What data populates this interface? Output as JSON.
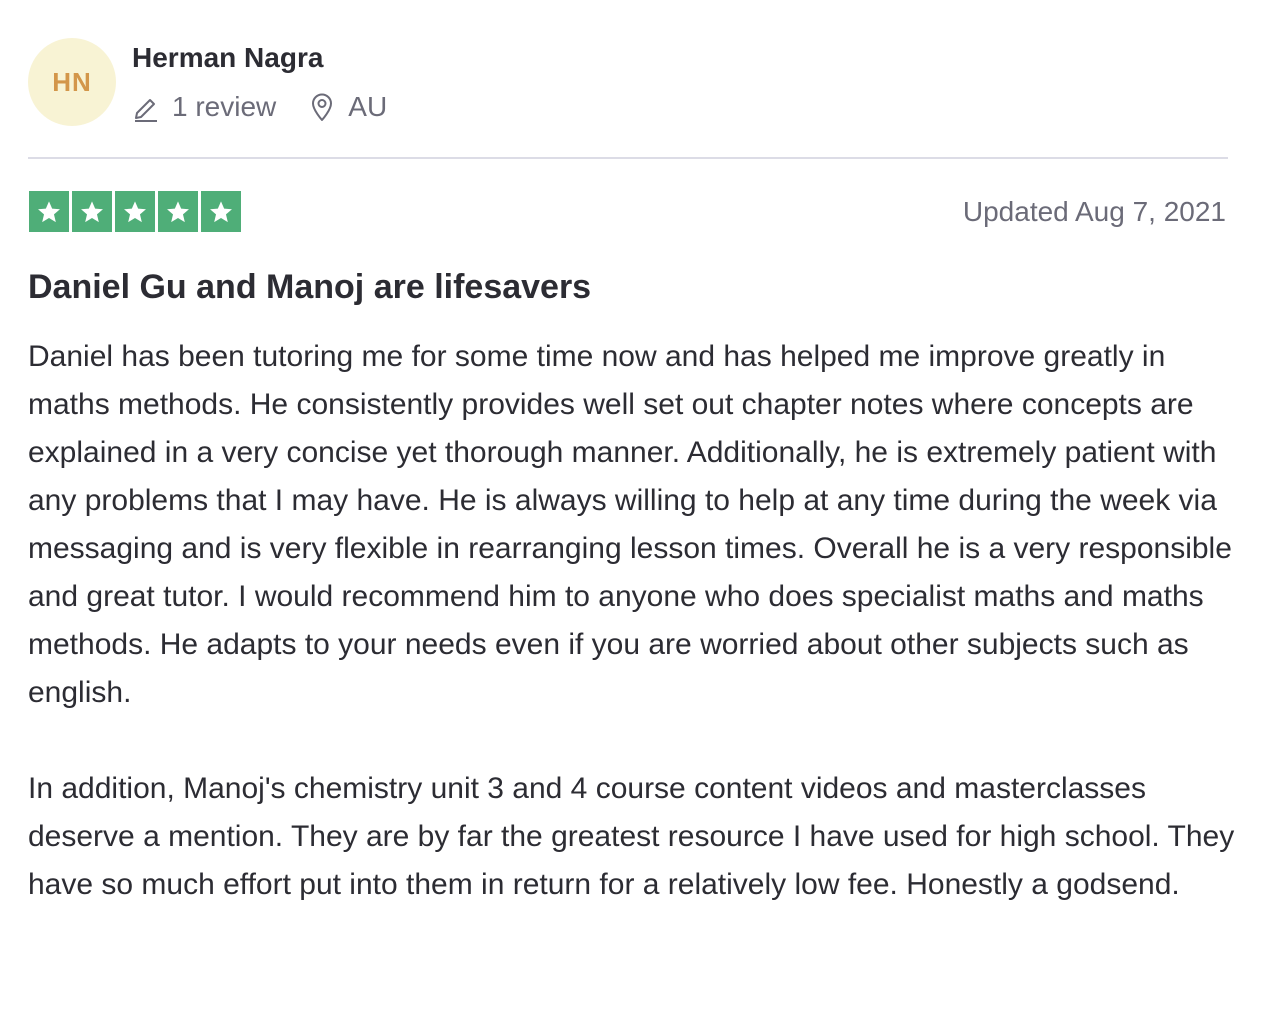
{
  "reviewer": {
    "initials": "HN",
    "name": "Herman Nagra",
    "review_count": "1 review",
    "country": "AU",
    "review_icon": "pencil-icon",
    "location_icon": "location-pin-icon"
  },
  "review": {
    "rating": 5,
    "rating_max": 5,
    "updated": "Updated Aug 7, 2021",
    "title": "Daniel Gu and Manoj are lifesavers",
    "paragraphs": [
      "Daniel has been tutoring me for some time now and has helped me improve greatly in maths methods. He consistently provides well set out chapter notes where concepts are explained in a very concise yet thorough manner. Additionally, he is extremely patient with any problems that I may have. He is always willing to help at any time during the week via messaging and is very flexible in rearranging lesson times. Overall he is a very responsible and great tutor. I would recommend him to anyone who does specialist maths and maths methods. He adapts to your needs even if you are worried about other subjects such as english.",
      "In addition, Manoj's chemistry unit 3 and 4 course content videos and masterclasses deserve a mention. They are by far the greatest resource I have used for high school. They have so much effort put into them in return for a relatively low fee. Honestly a godsend."
    ]
  },
  "colors": {
    "star_green": "#4fae78",
    "avatar_bg": "#f8f3d4",
    "avatar_text": "#d3964a",
    "meta_text": "#6b6b78",
    "divider": "#dcdce6"
  }
}
